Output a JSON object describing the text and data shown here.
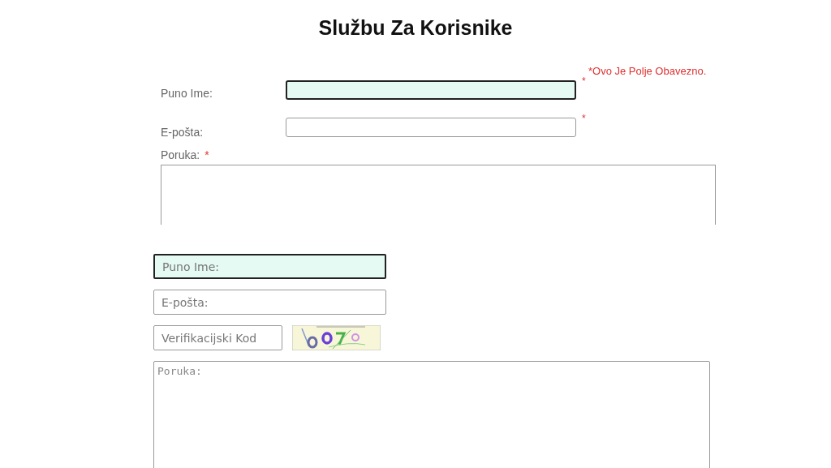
{
  "title": "Službu Za Korisnike",
  "form_1": {
    "required_note": "*Ovo Je Polje Obavezno.",
    "fields": [
      {
        "kind": "text",
        "label": "Puno Ime:",
        "required_mark": "*",
        "focused": true
      },
      {
        "kind": "text",
        "label": "E-pošta:",
        "required_mark": "*",
        "focused": false
      },
      {
        "kind": "textarea",
        "label": "Poruka:",
        "required_mark": "*",
        "focused": false
      }
    ]
  },
  "form_2": {
    "fields": [
      {
        "kind": "text",
        "placeholder": "Puno Ime:",
        "focused": true
      },
      {
        "kind": "text",
        "placeholder": "E-pošta:",
        "focused": false
      },
      {
        "kind": "captcha",
        "placeholder": "Verifikacijski Kod",
        "focused": false
      },
      {
        "kind": "textarea",
        "placeholder": "Poruka:",
        "focused": false
      }
    ]
  }
}
